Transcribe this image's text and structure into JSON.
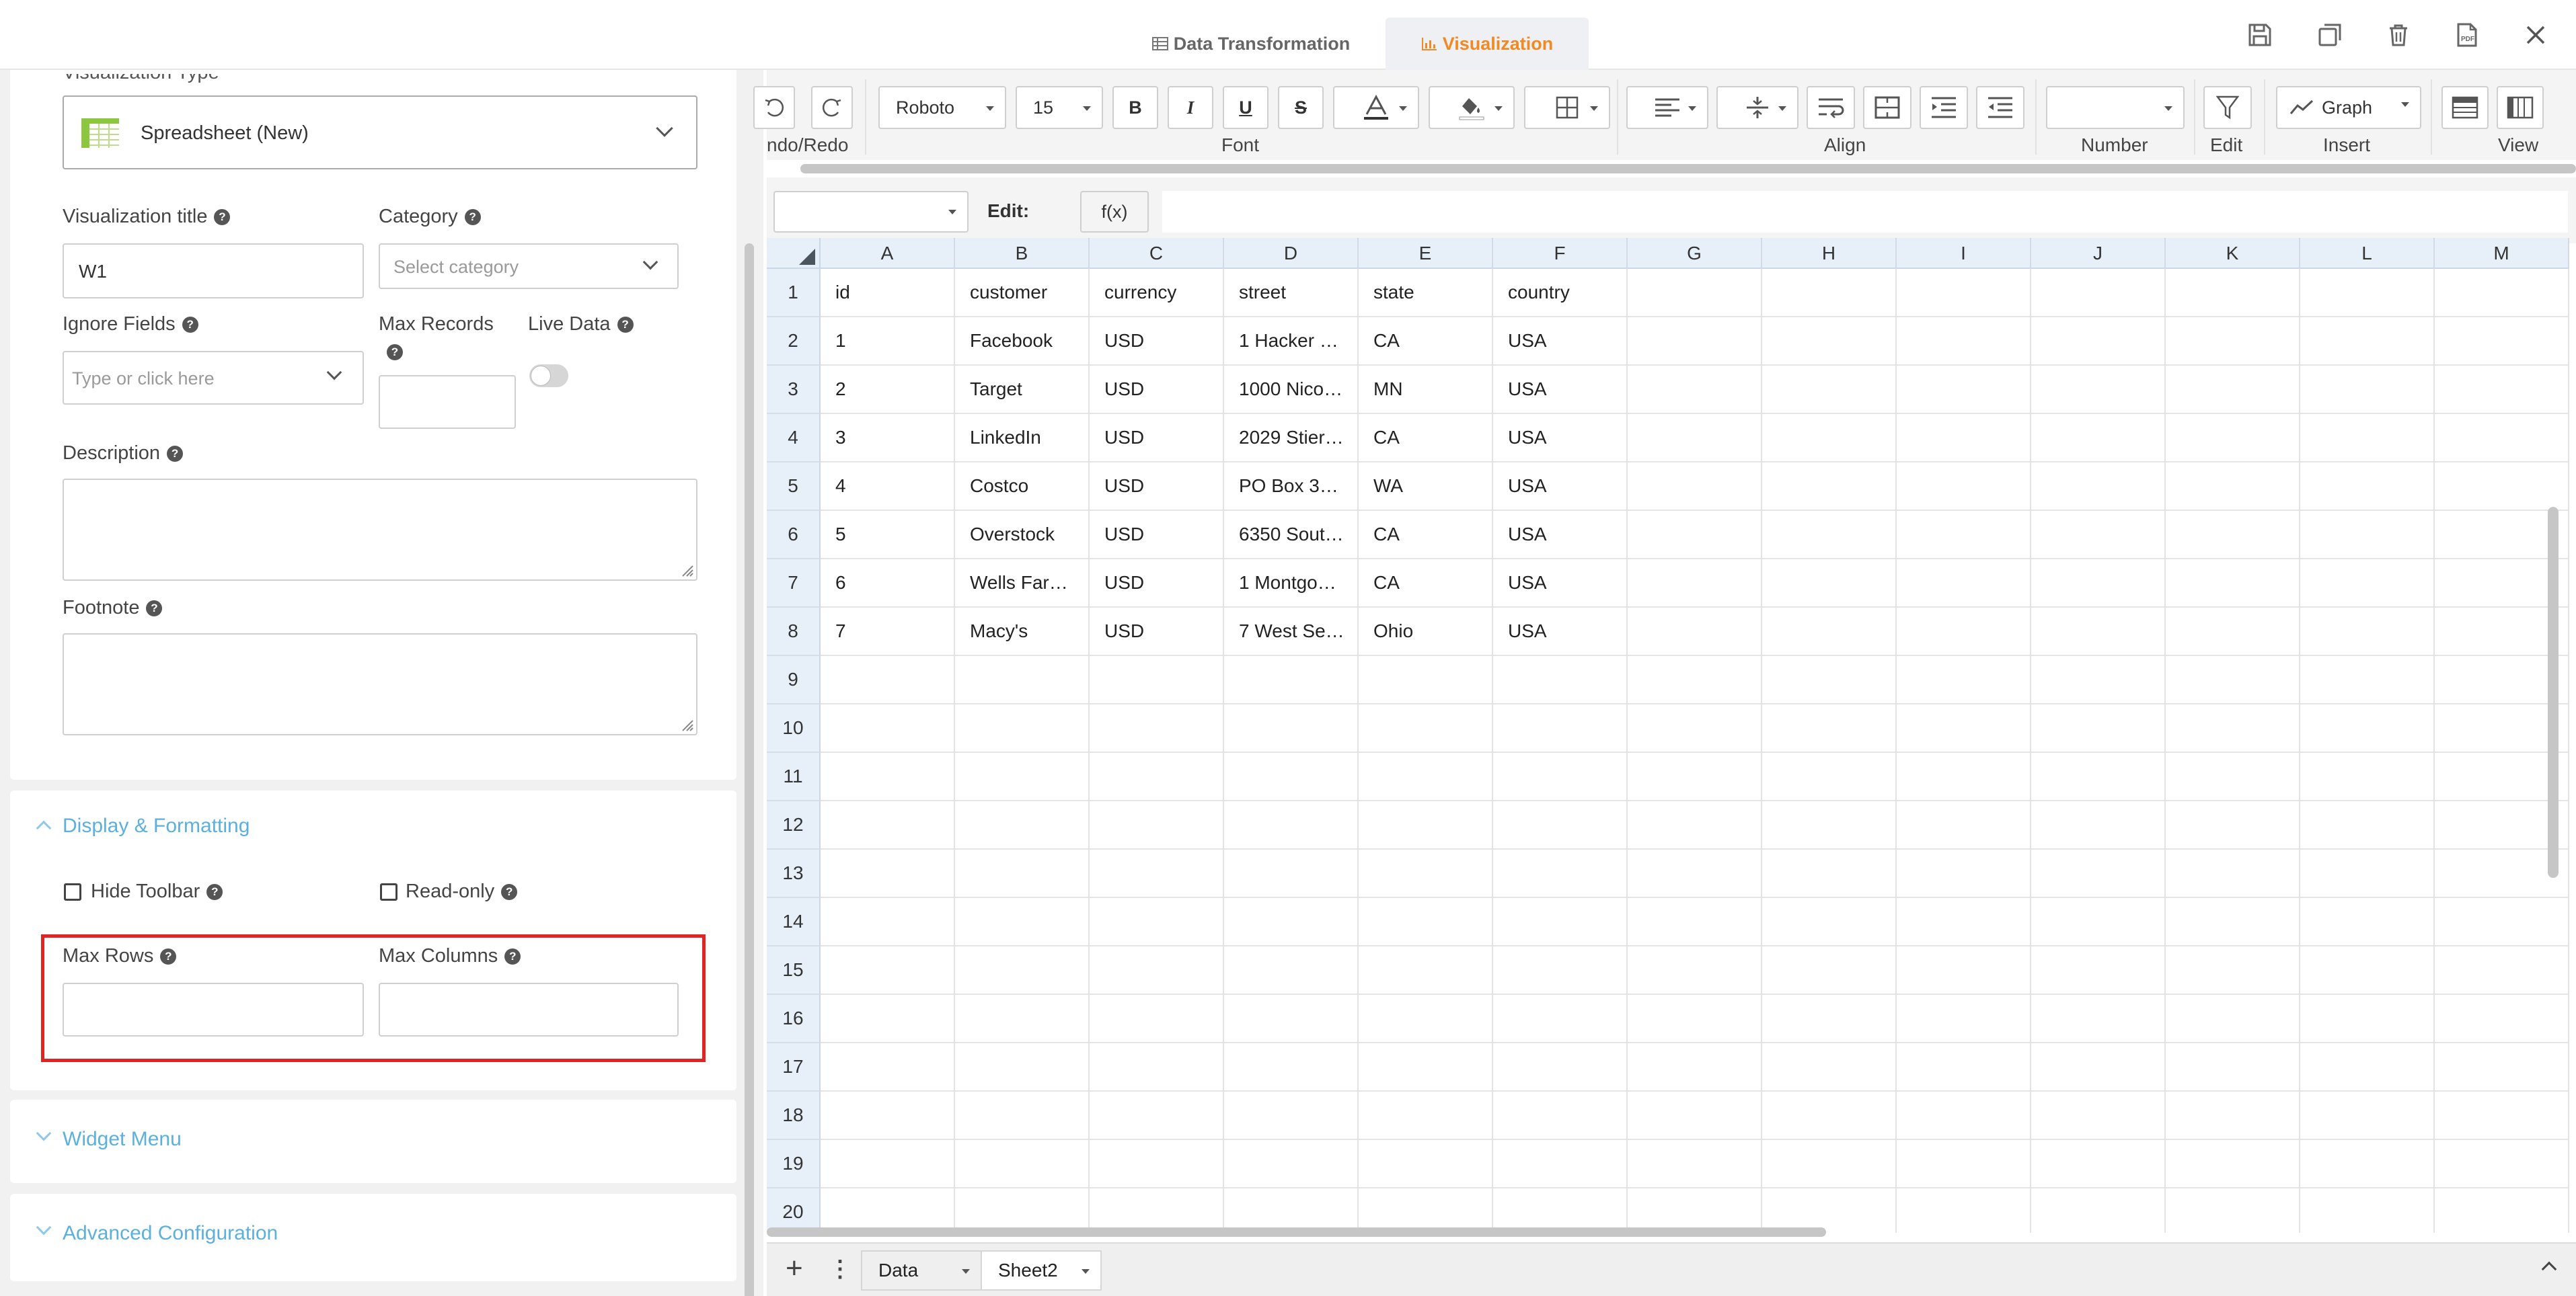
{
  "header": {
    "tabs": [
      {
        "label": "Data Transformation",
        "active": false
      },
      {
        "label": "Visualization",
        "active": true
      }
    ],
    "icons": [
      "save-icon",
      "duplicate-icon",
      "delete-icon",
      "pdf-export-icon",
      "close-icon"
    ],
    "accent": "#f08a24"
  },
  "left": {
    "viz_type_label": "Visualization Type",
    "viz_type_value": "Spreadsheet (New)",
    "viz_title_label": "Visualization title",
    "viz_title_value": "W1",
    "category_label": "Category",
    "category_placeholder": "Select category",
    "ignore_fields_label": "Ignore Fields",
    "ignore_fields_placeholder": "Type or click here",
    "max_records_label": "Max Records",
    "live_data_label": "Live Data",
    "live_data_on": false,
    "description_label": "Description",
    "footnote_label": "Footnote",
    "display_section": "Display & Formatting",
    "hide_toolbar_label": "Hide Toolbar",
    "readonly_label": "Read-only",
    "max_rows_label": "Max Rows",
    "max_columns_label": "Max Columns",
    "widget_menu": "Widget Menu",
    "advanced": "Advanced Configuration",
    "highlight_color": "#e02424",
    "section_color": "#5bb0de"
  },
  "ribbon": {
    "undo_label": "ndo/Redo",
    "font": "Roboto",
    "size": "15",
    "bold": "B",
    "italic": "I",
    "underline": "U",
    "strike": "S",
    "graph_label": "Graph",
    "number_value": "",
    "groups": {
      "font": "Font",
      "align": "Align",
      "number": "Number",
      "edit": "Edit",
      "insert": "Insert",
      "view": "View"
    }
  },
  "formula": {
    "cell_ref": "",
    "edit_label": "Edit:",
    "fx_label": "f(x)",
    "value": ""
  },
  "grid": {
    "columns": [
      "A",
      "B",
      "C",
      "D",
      "E",
      "F",
      "G",
      "H",
      "I",
      "J",
      "K",
      "L",
      "M"
    ],
    "rows": [
      "1",
      "2",
      "3",
      "4",
      "5",
      "6",
      "7",
      "8",
      "9",
      "10",
      "11",
      "12",
      "13",
      "14",
      "15",
      "16",
      "17",
      "18",
      "19",
      "20"
    ],
    "cells": [
      [
        "id",
        "customer",
        "currency",
        "street",
        "state",
        "country"
      ],
      [
        "1",
        "Facebook",
        "USD",
        "1 Hacker …",
        "CA",
        "USA"
      ],
      [
        "2",
        "Target",
        "USD",
        "1000 Nico…",
        "MN",
        "USA"
      ],
      [
        "3",
        "LinkedIn",
        "USD",
        "2029 Stier…",
        "CA",
        "USA"
      ],
      [
        "4",
        "Costco",
        "USD",
        "PO Box 3…",
        "WA",
        "USA"
      ],
      [
        "5",
        "Overstock",
        "USD",
        "6350 Sout…",
        "CA",
        "USA"
      ],
      [
        "6",
        "Wells Far…",
        "USD",
        "1 Montgo…",
        "CA",
        "USA"
      ],
      [
        "7",
        "Macy's",
        "USD",
        "7 West Se…",
        "Ohio",
        "USA"
      ]
    ]
  },
  "sheets": {
    "add": "+",
    "menu": "⋮",
    "tabs": [
      "Data",
      "Sheet2"
    ]
  }
}
